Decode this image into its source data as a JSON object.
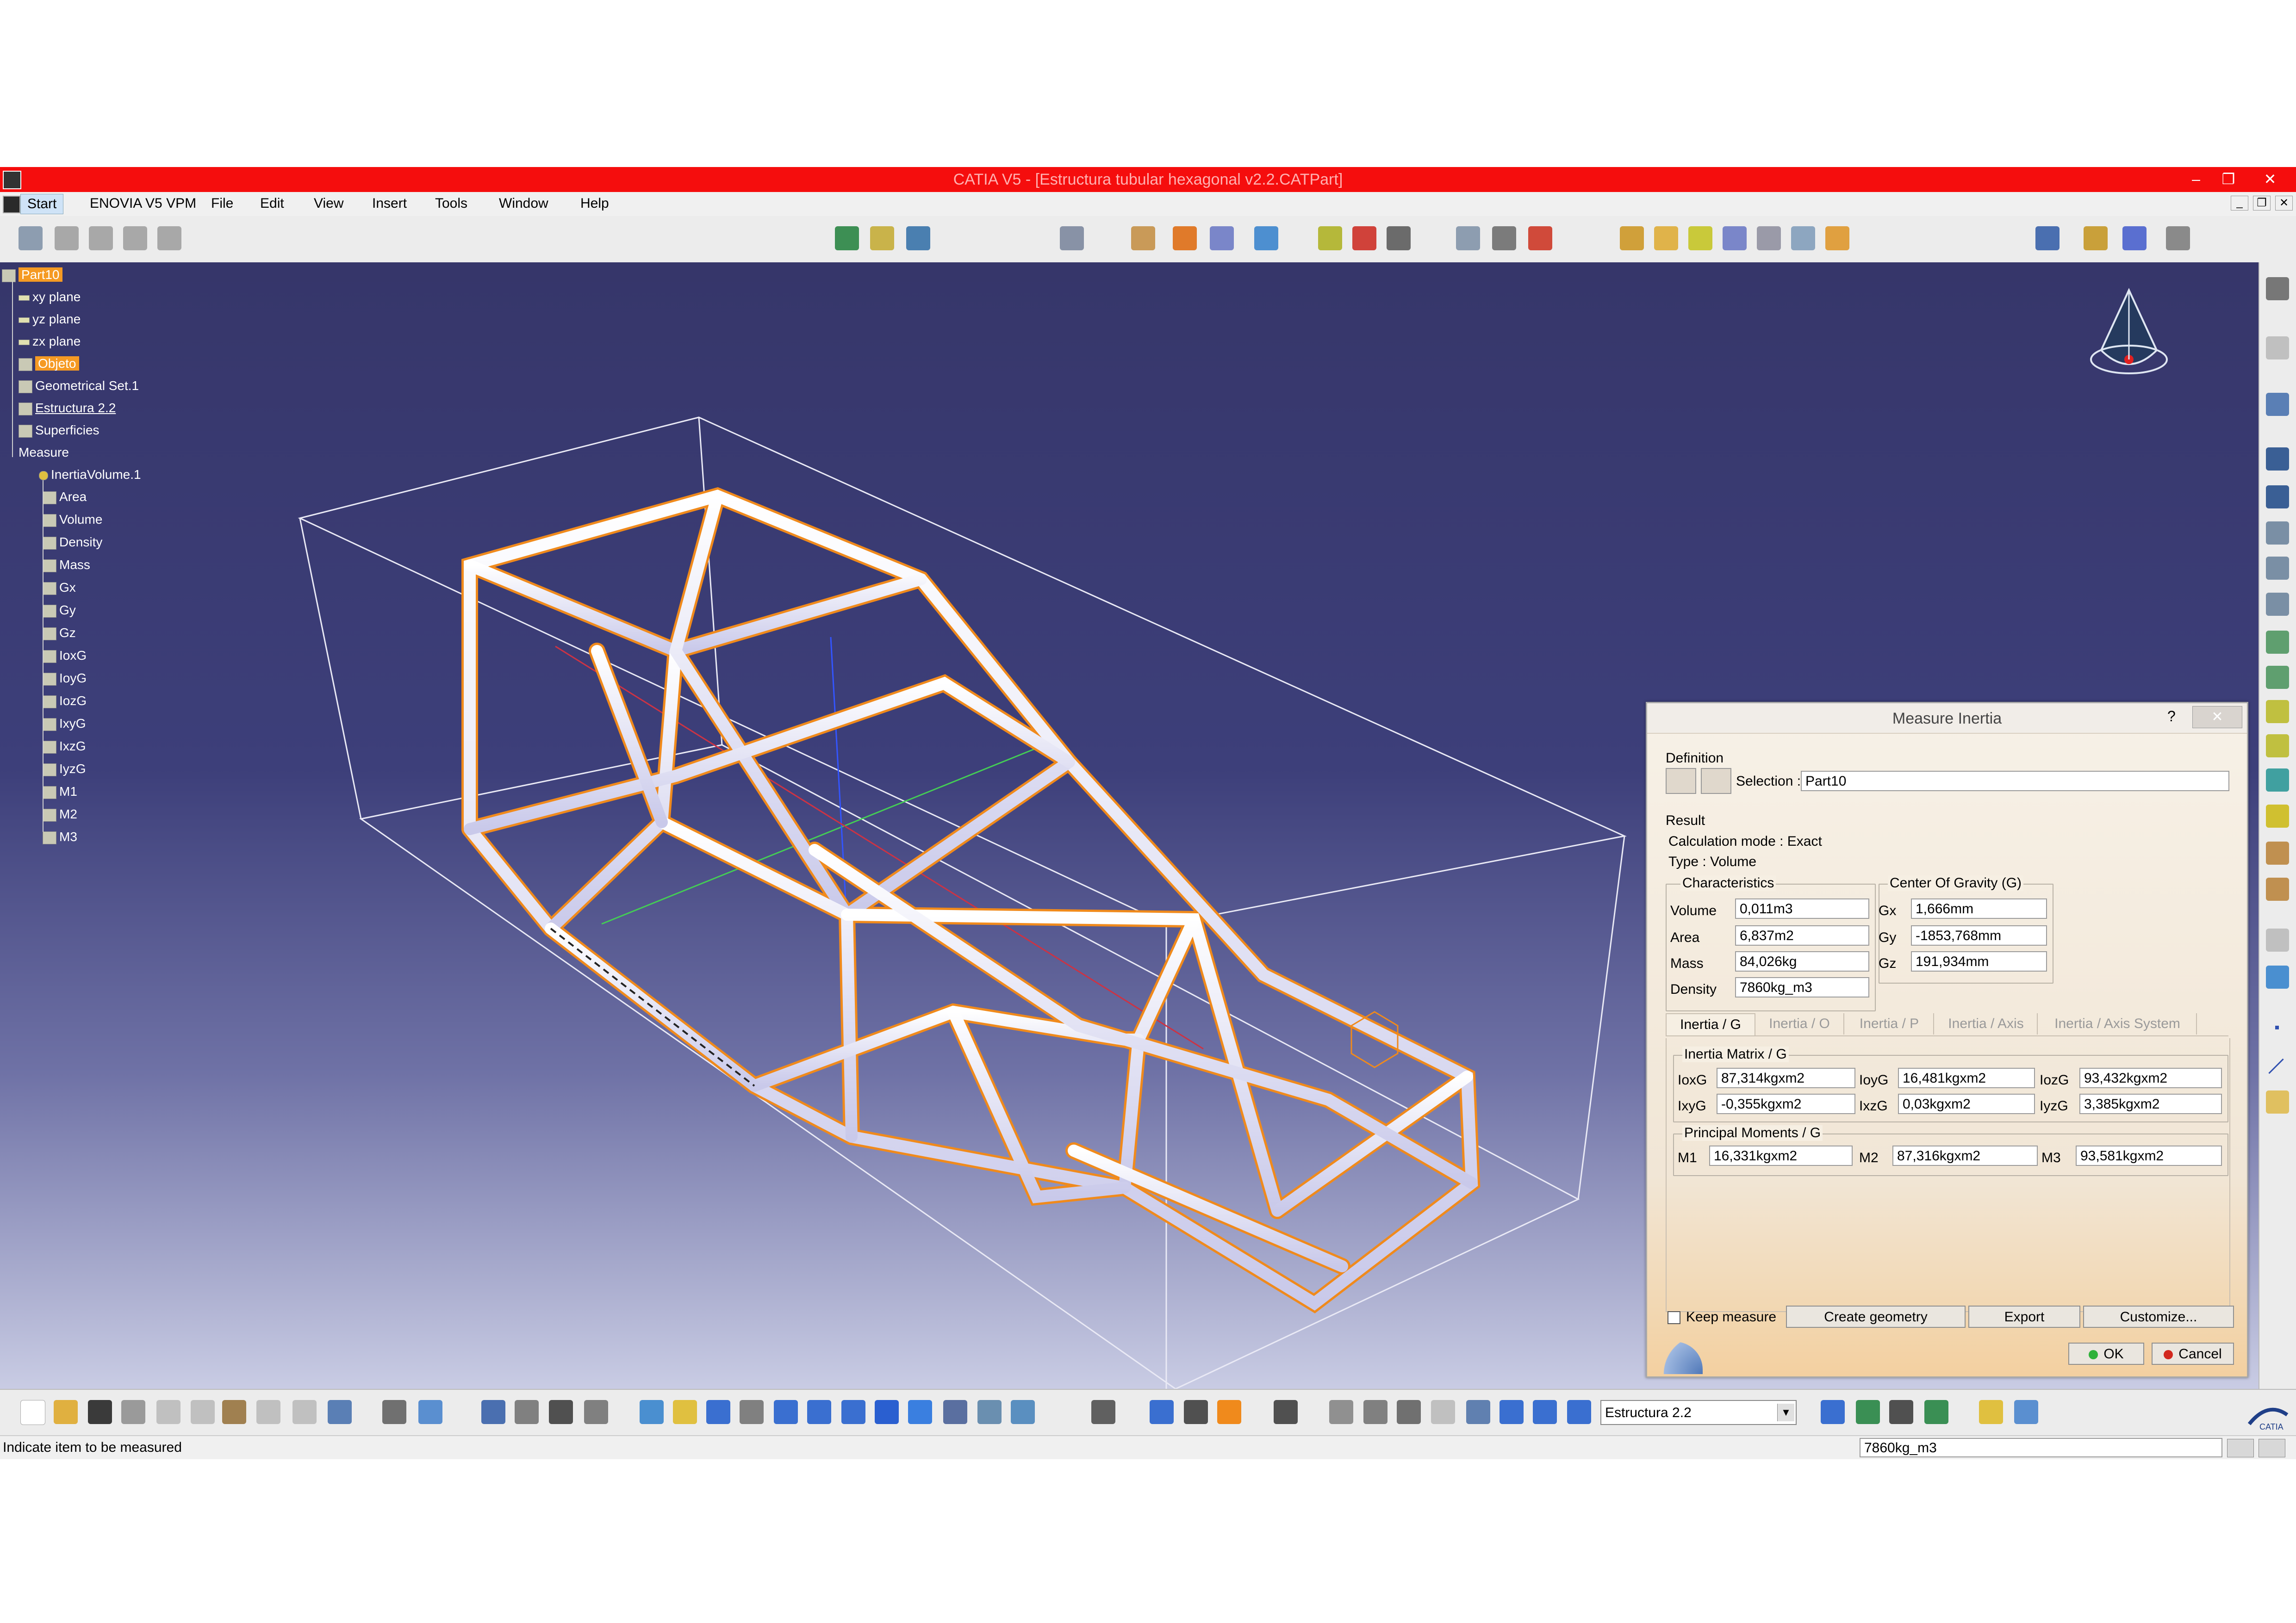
{
  "window": {
    "title": "CATIA V5 - [Estructura tubular hexagonal v2.2.CATPart]"
  },
  "menu": {
    "items": [
      "Start",
      "ENOVIA V5 VPM",
      "File",
      "Edit",
      "View",
      "Insert",
      "Tools",
      "Window",
      "Help"
    ]
  },
  "tree": {
    "root": "Part10",
    "planes": [
      "xy plane",
      "yz plane",
      "zx plane"
    ],
    "objeto": "Objeto",
    "sets": [
      "Geometrical Set.1",
      "Estructura 2.2",
      "Superficies"
    ],
    "measure": "Measure",
    "inertia_volume": "InertiaVolume.1",
    "params": [
      "Area",
      "Volume",
      "Density",
      "Mass",
      "Gx",
      "Gy",
      "Gz",
      "IoxG",
      "IoyG",
      "IozG",
      "IxyG",
      "IxzG",
      "IyzG",
      "M1",
      "M2",
      "M3"
    ]
  },
  "dialog": {
    "title": "Measure Inertia",
    "help": "?",
    "definition_label": "Definition",
    "selection_label": "Selection :",
    "selection_value": "Part10",
    "result_label": "Result",
    "calc_mode": "Calculation mode :  Exact",
    "type": "Type :  Volume",
    "characteristics_label": "Characteristics",
    "cog_label": "Center Of Gravity (G)",
    "characteristics": [
      {
        "label": "Volume",
        "value": "0,011m3"
      },
      {
        "label": "Area",
        "value": "6,837m2"
      },
      {
        "label": "Mass",
        "value": "84,026kg"
      },
      {
        "label": "Density",
        "value": "7860kg_m3"
      }
    ],
    "cog": [
      {
        "label": "Gx",
        "value": "1,666mm"
      },
      {
        "label": "Gy",
        "value": "-1853,768mm"
      },
      {
        "label": "Gz",
        "value": "191,934mm"
      }
    ],
    "tabs": [
      "Inertia / G",
      "Inertia / O",
      "Inertia / P",
      "Inertia / Axis",
      "Inertia / Axis System"
    ],
    "matrix_label": "Inertia Matrix / G",
    "matrix": [
      {
        "label": "IoxG",
        "value": "87,314kgxm2"
      },
      {
        "label": "IoyG",
        "value": "16,481kgxm2"
      },
      {
        "label": "IozG",
        "value": "93,432kgxm2"
      },
      {
        "label": "IxyG",
        "value": "-0,355kgxm2"
      },
      {
        "label": "IxzG",
        "value": "0,03kgxm2"
      },
      {
        "label": "IyzG",
        "value": "3,385kgxm2"
      }
    ],
    "principal_label": "Principal Moments / G",
    "principal": [
      {
        "label": "M1",
        "value": "16,331kgxm2"
      },
      {
        "label": "M2",
        "value": "87,316kgxm2"
      },
      {
        "label": "M3",
        "value": "93,581kgxm2"
      }
    ],
    "keep_measure": "Keep measure",
    "create_geometry": "Create geometry",
    "export": "Export",
    "customize": "Customize...",
    "ok": "OK",
    "cancel": "Cancel"
  },
  "bottom_toolbar": {
    "combo_value": "Estructura 2.2"
  },
  "status": {
    "message": "Indicate item to be measured",
    "field_value": "7860kg_m3"
  },
  "colors": {
    "titlebar": "#f50d0d",
    "selection_highlight": "#f59a23",
    "tube_edges": "#f08a1c"
  }
}
